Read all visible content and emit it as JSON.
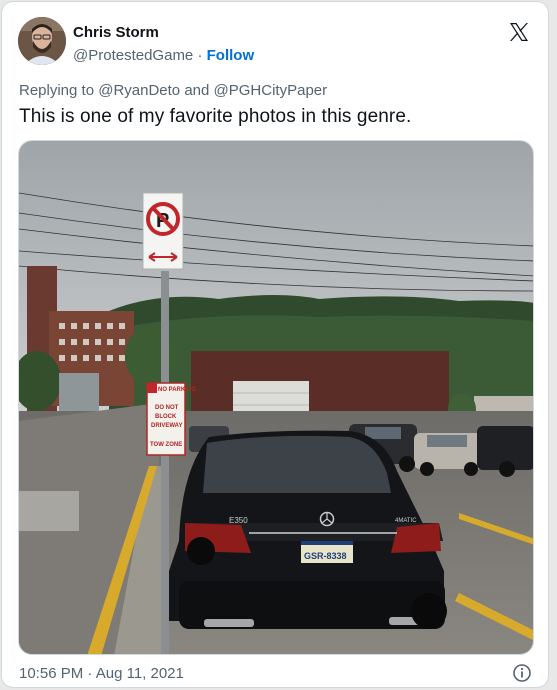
{
  "tweet": {
    "author_name": "Chris Storm",
    "handle": "@ProtestedGame",
    "separator": "·",
    "follow_label": "Follow",
    "reply_prefix": "Replying to",
    "reply_mention_1": "@RyanDeto",
    "reply_and": "and",
    "reply_mention_2": "@PGHCityPaper",
    "text": "This is one of my favorite photos in this genre.",
    "time": "10:56 PM",
    "date": "Aug 11, 2021"
  },
  "photo": {
    "sign_lines": [
      "NO PARKING",
      "DO NOT",
      "BLOCK",
      "DRIVEWAY",
      "TOW ZONE"
    ],
    "car_badge_left": "E350",
    "car_badge_right": "4MATIC",
    "plate": "GSR-8338"
  },
  "icons": {
    "platform_logo": "x-logo-icon",
    "info": "info-icon",
    "no_parking": "no-parking-sign-icon"
  },
  "colors": {
    "link": "#006fd6",
    "muted": "#536471",
    "border": "#cfd9de"
  }
}
